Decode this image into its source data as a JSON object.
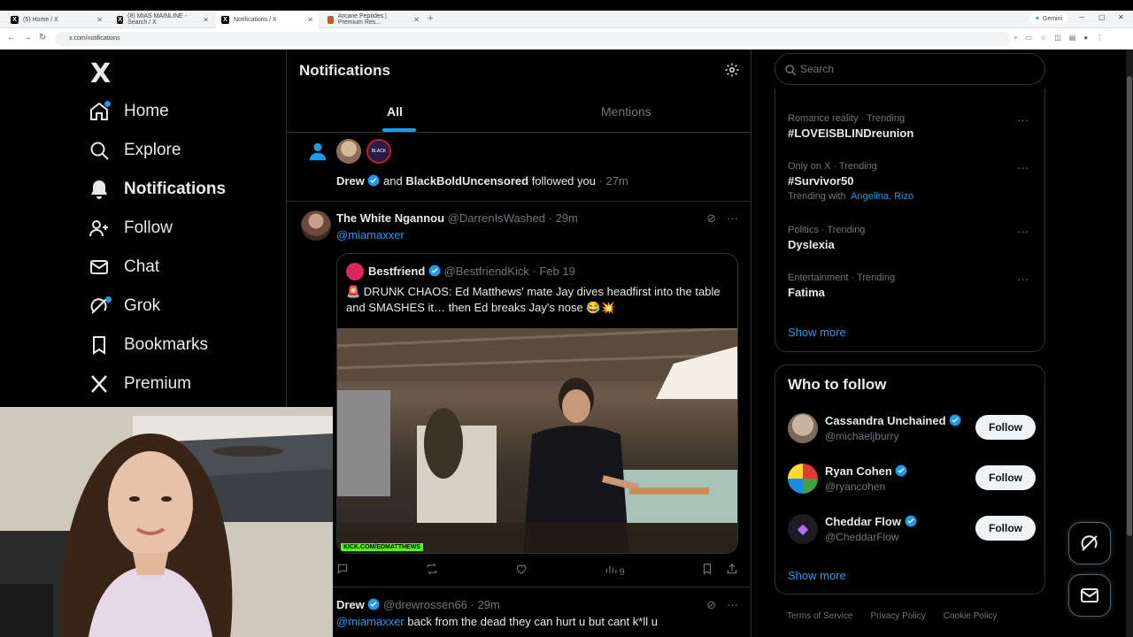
{
  "browser": {
    "tabs": [
      {
        "title": "(5) Home / X",
        "favicon": "X"
      },
      {
        "title": "(8) MIAS MAINLINE - Search / X",
        "favicon": "X"
      },
      {
        "title": "Notifications / X",
        "favicon": "X"
      },
      {
        "title": "Arcane Peptides | Premium Res...",
        "favicon": "AP"
      }
    ],
    "url": "x.com/notifications",
    "gemini_label": "Gemini"
  },
  "nav": {
    "logo": "X",
    "items": [
      {
        "label": "Home",
        "icon": "home-icon"
      },
      {
        "label": "Explore",
        "icon": "search-icon"
      },
      {
        "label": "Notifications",
        "icon": "bell-icon"
      },
      {
        "label": "Follow",
        "icon": "person-add-icon"
      },
      {
        "label": "Chat",
        "icon": "mail-icon"
      },
      {
        "label": "Grok",
        "icon": "grok-icon"
      },
      {
        "label": "Bookmarks",
        "icon": "bookmark-icon"
      },
      {
        "label": "Premium",
        "icon": "x-icon"
      }
    ]
  },
  "main": {
    "title": "Notifications",
    "tabs": [
      {
        "label": "All"
      },
      {
        "label": "Mentions"
      }
    ],
    "follow_notification": {
      "user1": "Drew",
      "conjunction": "and",
      "user2": "BlackBoldUncensored",
      "action": "followed you",
      "time": "· 27m",
      "avatar2_text": "BLACK BOLD"
    },
    "tweet": {
      "name": "The White Ngannou",
      "handle": "@DarrenIsWashed",
      "time": "· 29m",
      "mention": "@miamaxxer",
      "quote": {
        "name": "Bestfriend",
        "handle": "@BestfriendKick",
        "time": "· Feb 19",
        "text": "🚨 DRUNK CHAOS: Ed Matthews' mate Jay dives headfirst into the table and SMASHES it… then Ed breaks Jay's nose 😂💥",
        "watermark": "KICK.COM/EDMATTHEWS"
      },
      "views": "9"
    },
    "tweet2": {
      "name": "Drew",
      "handle": "@drewrossen66",
      "time": "· 29m",
      "mention": "@miamaxxer",
      "text": " back from the dead they can hurt u but cant k*ll u"
    }
  },
  "right": {
    "search_placeholder": "Search",
    "trends": [
      {
        "meta": "Romance reality · Trending",
        "name": "#LOVEISBLINDreunion"
      },
      {
        "meta": "Only on X · Trending",
        "name": "#Survivor50",
        "with_label": "Trending with",
        "with": "Angelina, Rizo"
      },
      {
        "meta": "Politics · Trending",
        "name": "Dyslexia"
      },
      {
        "meta": "Entertainment · Trending",
        "name": "Fatima"
      }
    ],
    "trends_show_more": "Show more",
    "who_to_follow": {
      "title": "Who to follow",
      "users": [
        {
          "name": "Cassandra Unchained",
          "handle": "@michaeljburry",
          "button": "Follow"
        },
        {
          "name": "Ryan Cohen",
          "handle": "@ryancohen",
          "button": "Follow"
        },
        {
          "name": "Cheddar Flow",
          "handle": "@CheddarFlow",
          "button": "Follow"
        }
      ],
      "show_more": "Show more"
    },
    "footer": [
      "Terms of Service",
      "Privacy Policy",
      "Cookie Policy"
    ]
  },
  "colors": {
    "accent": "#1d9bf0",
    "background": "#000000",
    "border": "#2f3336",
    "muted": "#71767b"
  }
}
